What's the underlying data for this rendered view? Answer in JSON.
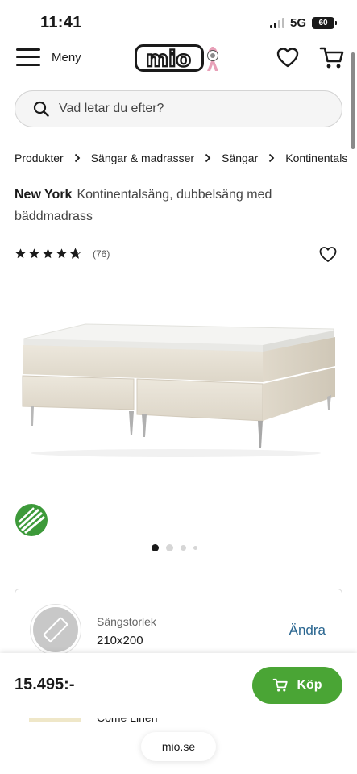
{
  "status_bar": {
    "time": "11:41",
    "network": "5G",
    "battery": "60"
  },
  "header": {
    "menu_label": "Meny",
    "logo_text": "mio"
  },
  "search": {
    "placeholder": "Vad letar du efter?"
  },
  "breadcrumb": [
    "Produkter",
    "Sängar & madrasser",
    "Sängar",
    "Kontinentals"
  ],
  "product": {
    "brand": "New York",
    "description": "Kontinentalsäng, dubbelsäng med bäddmadrass",
    "rating": 4.5,
    "review_count": "(76)"
  },
  "carousel": {
    "dots": 4,
    "active_index": 0
  },
  "size_selector": {
    "label": "Sängstorlek",
    "value": "210x200",
    "change_label": "Ändra"
  },
  "purchase": {
    "price": "15.495:-",
    "buy_label": "Köp"
  },
  "peek": {
    "text": "Come Linen"
  },
  "browser": {
    "url": "mio.se"
  },
  "colors": {
    "buy_green": "#4aa535",
    "link_blue": "#2a6690",
    "ribbon_pink": "#e8a0b8",
    "eco_green": "#3d9a3a"
  }
}
